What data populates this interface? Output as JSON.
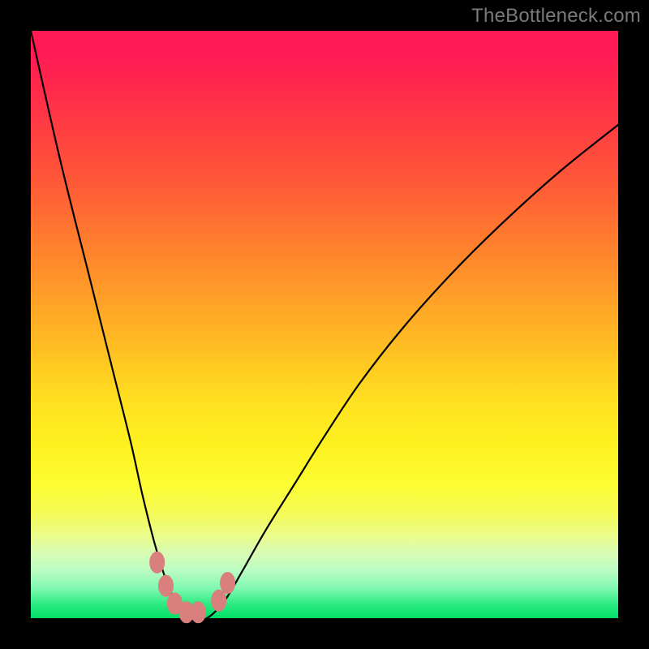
{
  "watermark": "TheBottleneck.com",
  "colors": {
    "frame": "#000000",
    "curve": "#000000",
    "marker_fill": "#d97f7d",
    "marker_stroke": "#d97f7d"
  },
  "chart_data": {
    "type": "line",
    "title": "",
    "xlabel": "",
    "ylabel": "",
    "xlim": [
      0,
      100
    ],
    "ylim": [
      0,
      100
    ],
    "grid": false,
    "legend": false,
    "series": [
      {
        "name": "bottleneck-curve",
        "x": [
          0,
          5,
          10,
          14,
          17,
          19,
          21,
          22.5,
          24,
          26,
          28,
          30,
          33,
          36,
          40,
          45,
          50,
          56,
          63,
          71,
          80,
          90,
          100
        ],
        "values": [
          100,
          78,
          58,
          42,
          30,
          21,
          13,
          8,
          4,
          1,
          0,
          0,
          3,
          8,
          15,
          23,
          31,
          40,
          49,
          58,
          67,
          76,
          84
        ]
      }
    ],
    "markers": [
      {
        "x": 21.5,
        "y": 9.5
      },
      {
        "x": 23.0,
        "y": 5.5
      },
      {
        "x": 24.5,
        "y": 2.5
      },
      {
        "x": 26.5,
        "y": 1.0
      },
      {
        "x": 28.5,
        "y": 1.0
      },
      {
        "x": 32.0,
        "y": 3.0
      },
      {
        "x": 33.5,
        "y": 6.0
      }
    ]
  }
}
